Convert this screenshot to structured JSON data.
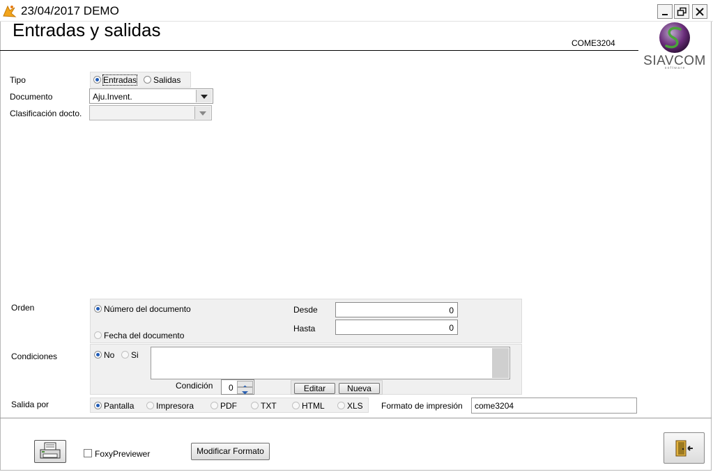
{
  "window": {
    "title": "23/04/2017  DEMO",
    "icon": "app-icon",
    "controls": [
      "minimize-icon",
      "restore-icon",
      "close-icon"
    ]
  },
  "header": {
    "title": "Entradas y salidas",
    "form_code": "COME3204",
    "logo_text": "SIAVCOM",
    "logo_subtext": "s o f t w a r e"
  },
  "filters": {
    "tipo_label": "Tipo",
    "tipo_options": [
      "Entradas",
      "Salidas"
    ],
    "tipo_selected": "Entradas",
    "documento_label": "Documento",
    "documento_value": "Aju.Invent.",
    "clasificacion_label": "Clasificación docto.",
    "clasificacion_value": ""
  },
  "orden": {
    "label": "Orden",
    "options": [
      "Número del documento",
      "Fecha del documento"
    ],
    "selected": "Número del documento",
    "desde_label": "Desde",
    "desde_value": "0",
    "hasta_label": "Hasta",
    "hasta_value": "0"
  },
  "condiciones": {
    "label": "Condiciones",
    "options": [
      "No",
      "Si"
    ],
    "selected": "No",
    "condicion_label": "Condición",
    "condicion_value": "0",
    "editar_label": "Editar",
    "nueva_label": "Nueva"
  },
  "salida": {
    "label": "Salida por",
    "options": [
      "Pantalla",
      "Impresora",
      "PDF",
      "TXT",
      "HTML",
      "XLS"
    ],
    "selected": "Pantalla",
    "formato_label": "Formato de impresión",
    "formato_value": "come3204"
  },
  "footer": {
    "print_icon": "printer-icon",
    "foxy_label": "FoxyPreviewer",
    "foxy_checked": false,
    "modificar_label": "Modificar Formato",
    "exit_icon": "exit-door-icon"
  },
  "colors": {
    "accent": "#1e5bb8",
    "logo_purple": "#6a2d7a",
    "logo_green": "#4aa33a",
    "panel": "#f0f0f0"
  }
}
